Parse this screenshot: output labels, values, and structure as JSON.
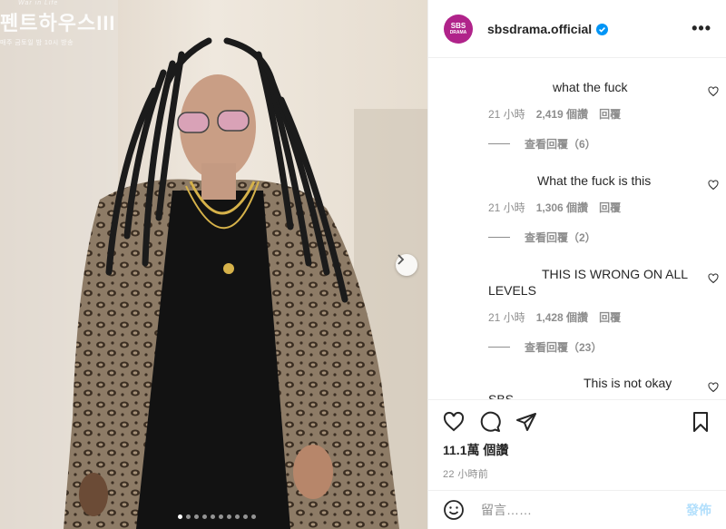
{
  "media": {
    "watermark_title": "펜트하우스III",
    "watermark_sub": "매주 금토일 밤 10시 방송",
    "watermark_tiny": "War in Life",
    "carousel_dots": 10,
    "active_dot": 0
  },
  "header": {
    "avatar_line1": "SBS",
    "avatar_line2": "DRAMA",
    "username": "sbsdrama.official",
    "more": "•••"
  },
  "comments": [
    {
      "text": "what the fuck",
      "time": "21 小時",
      "likes": "2,419 個讚",
      "reply": "回覆",
      "view_replies": "查看回覆（6）"
    },
    {
      "text": "What the fuck is this",
      "time": "21 小時",
      "likes": "1,306 個讚",
      "reply": "回覆",
      "view_replies": "查看回覆（2）"
    },
    {
      "text": "THIS IS WRONG ON ALL LEVELS",
      "time": "21 小時",
      "likes": "1,428 個讚",
      "reply": "回覆",
      "view_replies": "查看回覆（23）"
    },
    {
      "text": "This is not okay",
      "text_cut": "SBS"
    }
  ],
  "post": {
    "likes_count": "11.1萬 個讚",
    "time_ago": "22 小時前"
  },
  "add_comment": {
    "placeholder": "留言……",
    "post_label": "發佈"
  },
  "colors": {
    "accent": "#0095f6",
    "post_disabled": "#b2dffc",
    "avatar": "#b0238a"
  }
}
